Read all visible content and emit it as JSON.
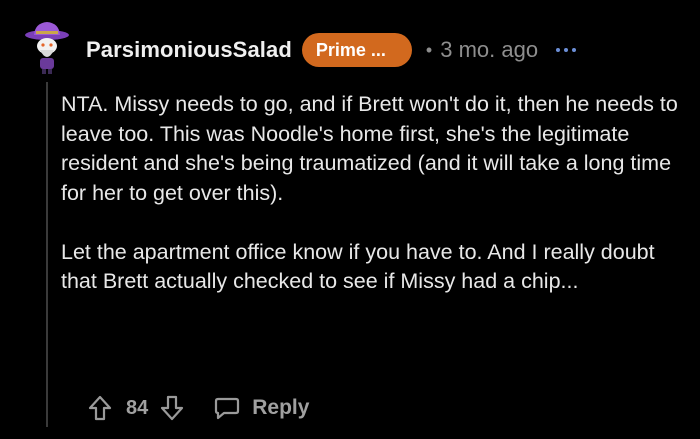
{
  "comment": {
    "author": "ParsimoniousSalad",
    "flair": "Prime ...",
    "separator": "•",
    "timestamp": "3 mo. ago",
    "paragraphs": [
      "NTA. Missy needs to go, and if Brett won't do it, then he needs to leave too. This was Noodle's home first, she's the legitimate resident and she's being traumatized (and it will take a long time for her to get over this).",
      "Let the apartment office know if you have to. And I really doubt that Brett actually checked to see if Missy had a chip..."
    ],
    "score": "84",
    "reply_label": "Reply"
  },
  "icons": {
    "avatar": "snoo-avatar-purple-hat",
    "more": "more-dots-icon",
    "upvote": "upvote-arrow-icon",
    "downvote": "downvote-arrow-icon",
    "reply": "reply-bubble-icon"
  },
  "colors": {
    "background": "#000000",
    "flair_bg": "#d2691e",
    "more_dots": "#6b8ed6",
    "muted_text": "#8e8e8e"
  }
}
